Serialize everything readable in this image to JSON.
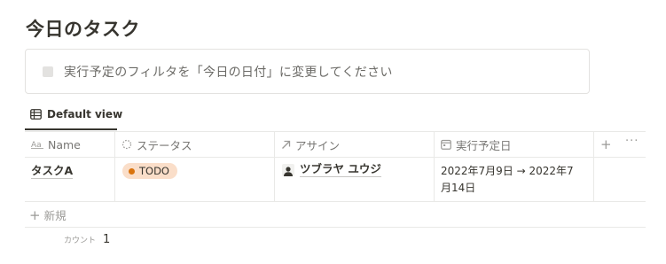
{
  "page": {
    "title": "今日のタスク"
  },
  "callout": {
    "text": "実行予定のフィルタを「今日の日付」に変更してください"
  },
  "view": {
    "label": "Default view"
  },
  "table": {
    "columns": [
      {
        "label": "Name",
        "icon": "text-property-icon"
      },
      {
        "label": "ステータス",
        "icon": "status-property-icon"
      },
      {
        "label": "アサイン",
        "icon": "relation-arrow-icon"
      },
      {
        "label": "実行予定日",
        "icon": "calendar-icon"
      }
    ],
    "rows": [
      {
        "name": "タスクA",
        "status": "TODO",
        "assignee": "ツブラヤ ユウジ",
        "date_line1": "2022年7月9日 → 2022年7",
        "date_line2": "月14日"
      }
    ],
    "new_label": "新規",
    "count_label": "カウント",
    "count_value": "1"
  },
  "colors": {
    "status_bg": "#fadec9",
    "status_dot": "#d9730d",
    "text": "#37352f",
    "muted": "#787774"
  }
}
